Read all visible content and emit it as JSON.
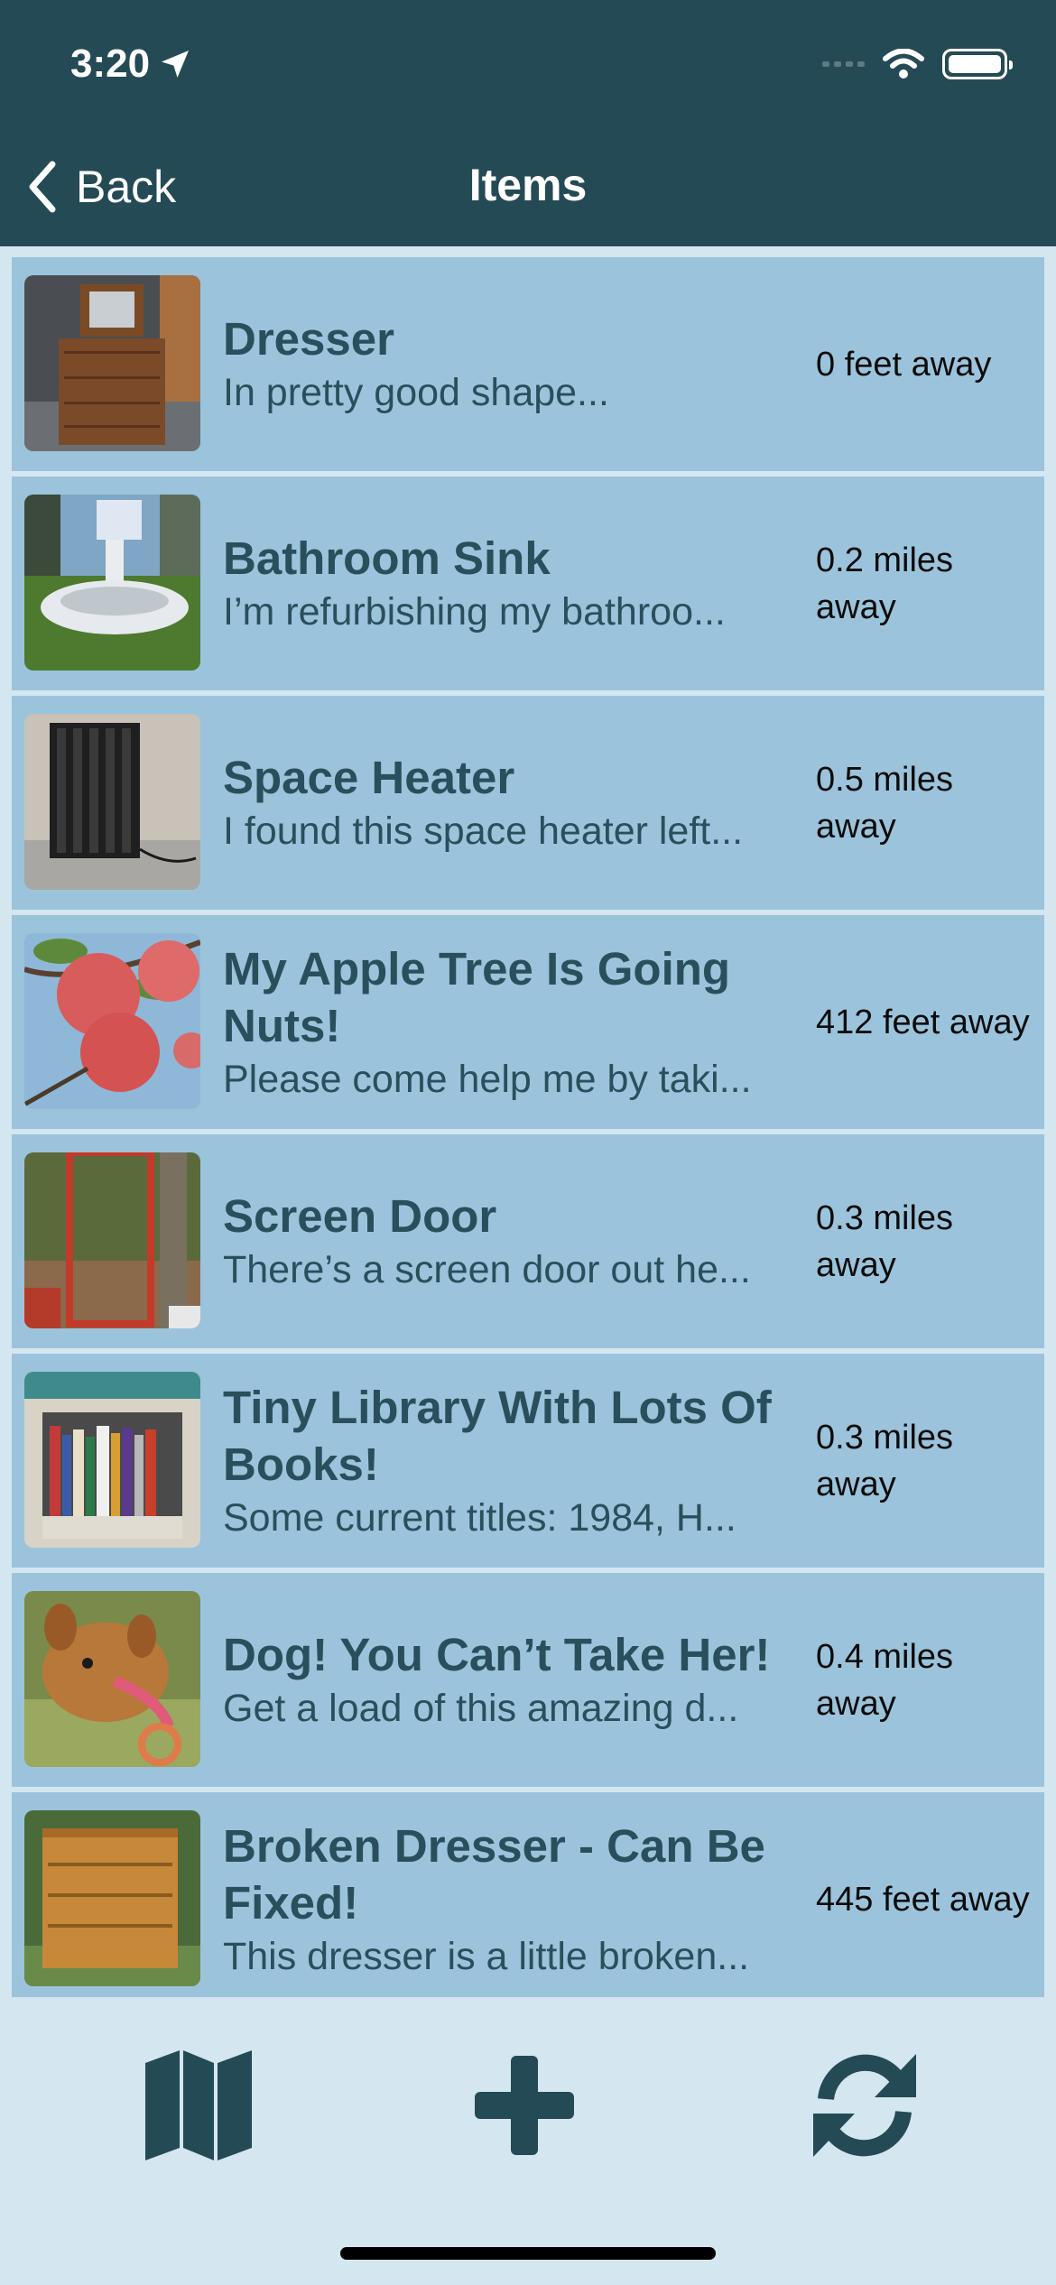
{
  "status_bar": {
    "time": "3:20"
  },
  "nav": {
    "back_label": "Back",
    "title": "Items"
  },
  "items": [
    {
      "title": "Dresser",
      "description": "In pretty good shape...",
      "distance": "0 feet away"
    },
    {
      "title": "Bathroom Sink",
      "description": "I’m refurbishing my bathroo...",
      "distance": "0.2 miles away"
    },
    {
      "title": "Space Heater",
      "description": "I found this space heater left...",
      "distance": "0.5 miles away"
    },
    {
      "title": "My Apple Tree Is Going Nuts!",
      "description": "Please come help me by taki...",
      "distance": "412 feet away"
    },
    {
      "title": "Screen Door",
      "description": "There’s a screen door out he...",
      "distance": "0.3 miles away"
    },
    {
      "title": "Tiny Library With Lots Of Books!",
      "description": "Some current titles: 1984, H...",
      "distance": "0.3 miles away"
    },
    {
      "title": "Dog! You Can’t Take Her!",
      "description": "Get a load of this amazing d...",
      "distance": "0.4 miles away"
    },
    {
      "title": "Broken Dresser - Can Be Fixed!",
      "description": "This dresser is a little broken...",
      "distance": "445 feet away"
    }
  ],
  "tabbar": {
    "icons": [
      "map-icon",
      "plus-icon",
      "refresh-icon"
    ]
  },
  "colors": {
    "header": "#244a55",
    "row": "#9bc4dc",
    "background": "#d4e6ef",
    "text": "#2a4f5c"
  }
}
